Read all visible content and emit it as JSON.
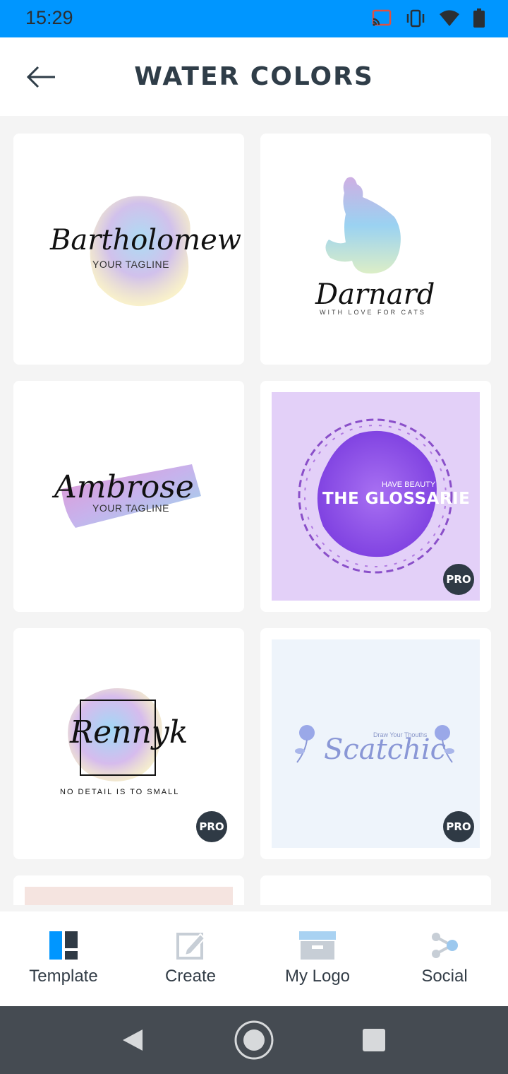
{
  "status_bar": {
    "time": "15:29",
    "icons": [
      "cast-icon",
      "vibrate-icon",
      "wifi-icon",
      "battery-icon"
    ],
    "color": "#0096ff"
  },
  "header": {
    "title": "WATER COLORS",
    "back_icon": "arrow-left-icon"
  },
  "templates": [
    {
      "name": "Bartholomew",
      "tagline": "YOUR TAGLINE",
      "pro": false
    },
    {
      "name": "Darnard",
      "tagline": "WITH LOVE FOR CATS",
      "pro": false
    },
    {
      "name": "Ambrose",
      "tagline": "YOUR TAGLINE",
      "pro": false
    },
    {
      "name": "THE GLOSSARIE",
      "tagline": "HAVE BEAUTY",
      "pro": true,
      "badge": "PRO"
    },
    {
      "name": "Rennyk",
      "tagline": "NO DETAIL IS TO SMALL",
      "pro": true,
      "badge": "PRO"
    },
    {
      "name": "Scatchic",
      "tagline": "Draw Your Thouths",
      "pro": true,
      "badge": "PRO"
    }
  ],
  "bottom_nav": [
    {
      "label": "Template",
      "icon": "template-icon",
      "active": true
    },
    {
      "label": "Create",
      "icon": "edit-icon",
      "active": false
    },
    {
      "label": "My Logo",
      "icon": "archive-icon",
      "active": false
    },
    {
      "label": "Social",
      "icon": "share-icon",
      "active": false
    }
  ],
  "colors": {
    "accent": "#0096ff",
    "title": "#2f3d48",
    "badge": "#2f3a45"
  }
}
